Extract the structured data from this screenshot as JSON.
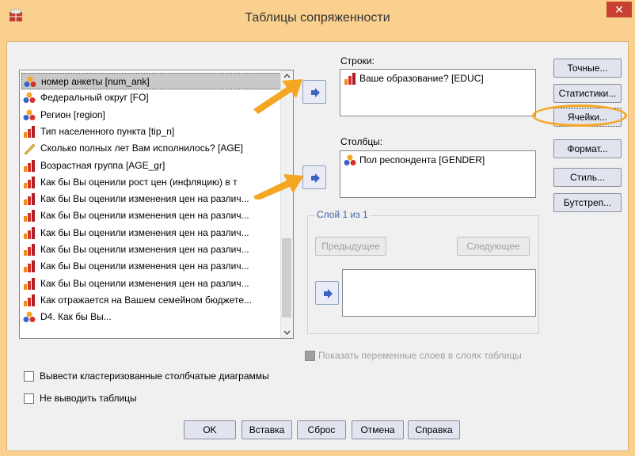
{
  "window": {
    "title": "Таблицы сопряженности",
    "close_label": "✕",
    "icon": "spss-crosstabs-icon"
  },
  "variables": [
    {
      "label": "номер анкеты [num_ank]",
      "icon": "nominal-icon",
      "selected": true
    },
    {
      "label": "Федеральный округ [FO]",
      "icon": "nominal-icon"
    },
    {
      "label": "Регион [region]",
      "icon": "nominal-icon"
    },
    {
      "label": "Тип населенного пункта [tip_n]",
      "icon": "ordinal-icon"
    },
    {
      "label": "Сколько полных лет Вам исполнилось? [AGE]",
      "icon": "scale-icon"
    },
    {
      "label": "Возрастная группа [AGE_gr]",
      "icon": "ordinal-icon"
    },
    {
      "label": "Как бы Вы оценили рост цен (инфляцию) в т",
      "icon": "ordinal-icon"
    },
    {
      "label": "Как бы Вы оценили изменения цен на различ...",
      "icon": "ordinal-icon"
    },
    {
      "label": "Как бы Вы оценили изменения цен на различ...",
      "icon": "ordinal-icon"
    },
    {
      "label": "Как бы Вы оценили изменения цен на различ...",
      "icon": "ordinal-icon"
    },
    {
      "label": "Как бы Вы оценили изменения цен на различ...",
      "icon": "ordinal-icon"
    },
    {
      "label": "Как бы Вы оценили изменения цен на различ...",
      "icon": "ordinal-icon"
    },
    {
      "label": "Как бы Вы оценили изменения цен на различ...",
      "icon": "ordinal-icon"
    },
    {
      "label": "Как отражается на Вашем семейном бюджете...",
      "icon": "ordinal-icon"
    },
    {
      "label": "D4. Как бы Вы...",
      "icon": "nominal-icon"
    }
  ],
  "rows": {
    "caption": "Строки:",
    "item": "Ваше образование? [EDUC]",
    "icon": "ordinal-icon"
  },
  "columns": {
    "caption": "Столбцы:",
    "item": "Пол респондента [GENDER]",
    "icon": "nominal-icon"
  },
  "layer": {
    "caption": "Слой 1 из 1",
    "prev": "Предыдущее",
    "next": "Следующее"
  },
  "right_buttons": [
    "Точные...",
    "Статистики...",
    "Ячейки...",
    "Формат...",
    "Стиль...",
    "Бутстреп..."
  ],
  "show_layers_label": "Показать переменные слоев в слоях таблицы",
  "clustered_bars_label": "Вывести кластеризованные столбчатые диаграммы",
  "suppress_tables_label": "Не выводить таблицы",
  "bottom_buttons": {
    "ok": "OK",
    "paste": "Вставка",
    "reset": "Сброс",
    "cancel": "Отмена",
    "help": "Справка"
  },
  "colors": {
    "accent_border": "#fad08f",
    "annotation": "#f5a623",
    "close": "#c84031",
    "arrow_blue": "#3b63c4"
  }
}
